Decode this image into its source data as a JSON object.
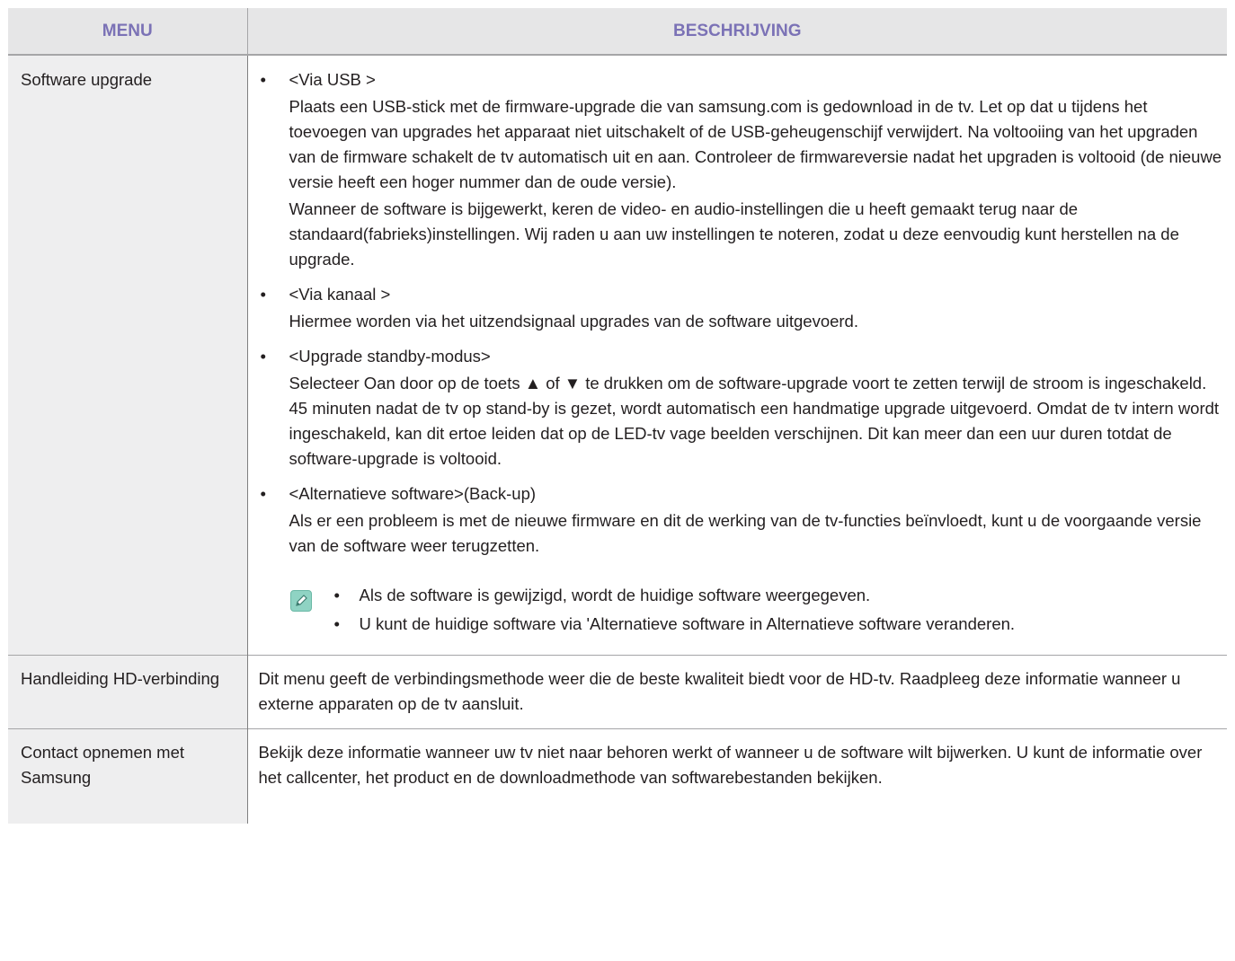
{
  "header": {
    "menu": "MENU",
    "description": "BESCHRIJVING"
  },
  "rows": [
    {
      "menu": "Software upgrade",
      "items": [
        {
          "title": "<Via USB >",
          "paragraphs": [
            "Plaats een USB-stick met de firmware-upgrade die van samsung.com is gedownload in de tv. Let op dat u tijdens het toevoegen van upgrades het apparaat niet uitschakelt of de USB-geheugenschijf verwijdert. Na voltooiing van het upgraden van de firmware schakelt de tv automatisch uit en aan. Controleer de firmwareversie nadat het upgraden is voltooid (de nieuwe versie heeft een hoger nummer dan de oude versie).",
            "Wanneer de software is bijgewerkt, keren de video- en audio-instellingen die u heeft gemaakt terug naar de standaard(fabrieks)instellingen. Wij raden u aan uw instellingen te noteren, zodat u deze eenvoudig kunt herstellen na de upgrade."
          ]
        },
        {
          "title": "<Via kanaal >",
          "paragraphs": [
            "Hiermee worden via het uitzendsignaal upgrades van de software uitgevoerd."
          ]
        },
        {
          "title": "<Upgrade standby-modus>",
          "paragraphs": [
            "Selecteer Oan door op de toets ▲ of ▼ te drukken om de software-upgrade voort te zetten terwijl de stroom is ingeschakeld. 45 minuten nadat de tv op stand-by is gezet, wordt automatisch een handmatige upgrade uitgevoerd. Omdat de tv intern wordt ingeschakeld, kan dit ertoe leiden dat op de LED-tv vage beelden verschijnen. Dit kan meer dan een uur duren totdat de software-upgrade is voltooid."
          ]
        },
        {
          "title": "<Alternatieve software>(Back-up)",
          "paragraphs": [
            "Als er een probleem is met de nieuwe firmware en dit de werking van de tv-functies beïnvloedt, kunt u de voorgaande versie van de software weer terugzetten."
          ]
        }
      ],
      "notes": [
        "Als de software is gewijzigd, wordt de huidige software weergegeven.",
        "U kunt de huidige software via 'Alternatieve software in Alternatieve software veranderen."
      ],
      "note_icon": "note-pencil-icon",
      "bullet": "•"
    },
    {
      "menu": "Handleiding HD-verbinding",
      "description": "Dit menu geeft de verbindingsmethode weer die de beste kwaliteit biedt voor de HD-tv. Raadpleeg deze informatie wanneer u externe apparaten op de tv aansluit."
    },
    {
      "menu": "Contact opnemen met Samsung",
      "description": "Bekijk deze informatie wanneer uw tv niet naar behoren werkt of wanneer u de software wilt bijwerken. U kunt de informatie over het callcenter, het product en de downloadmethode van softwarebestanden bekijken."
    }
  ],
  "colors": {
    "header_text": "#7b72b6",
    "header_bg": "#e6e6e7",
    "menu_bg": "#eeeeef",
    "note_icon": "#8fd3c3"
  }
}
